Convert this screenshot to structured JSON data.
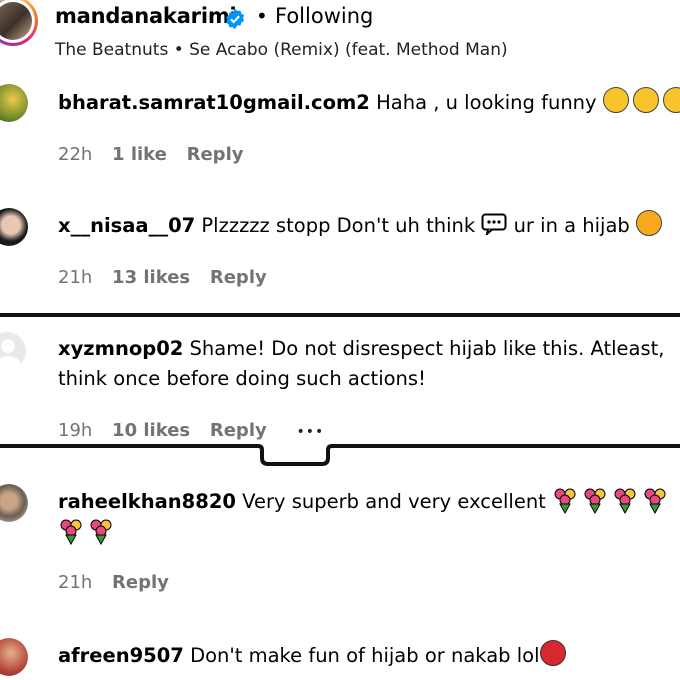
{
  "header": {
    "username": "mandanakarimi",
    "separator": "•",
    "follow_status": "Following",
    "song": "The Beatnuts • Se Acabo (Remix) (feat. Method Man)"
  },
  "comments": [
    {
      "username": "bharat.samrat10gmail.com2",
      "text": "Haha , u looking funny",
      "time": "22h",
      "likes": "1 like",
      "reply": "Reply"
    },
    {
      "username": "x__nisaa__07",
      "text_before": "Plzzzzz stopp Don't uh think",
      "text_after": "ur in a hijab",
      "time": "21h",
      "likes": "13 likes",
      "reply": "Reply"
    },
    {
      "username": "xyzmnop02",
      "text": "Shame! Do not disrespect hijab like this. Atleast,",
      "text_line2": "think once before doing such actions!",
      "time": "19h",
      "likes": "10 likes",
      "reply": "Reply",
      "more": "•••"
    },
    {
      "username": "raheelkhan8820",
      "text": "Very superb and very excellent",
      "time": "21h",
      "reply": "Reply"
    },
    {
      "username": "afreen9507",
      "text": "Don't make fun of hijab or nakab lol"
    }
  ],
  "colors": {
    "meta_gray": "#737373",
    "verified_blue": "#0095f6"
  }
}
